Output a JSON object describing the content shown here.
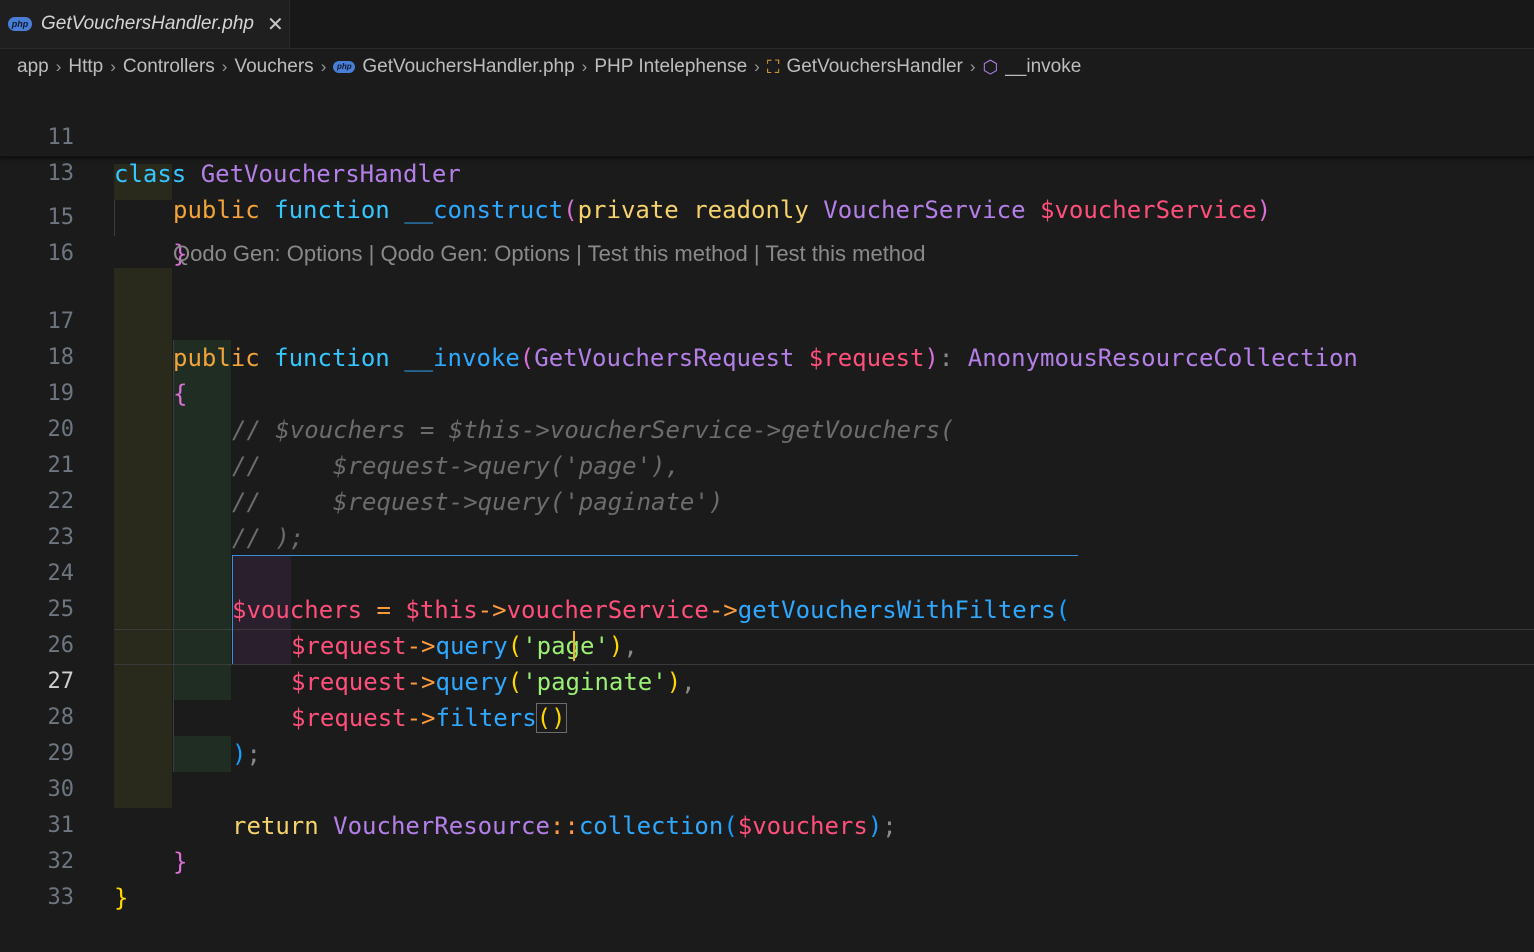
{
  "tab": {
    "icon": "php",
    "title": "GetVouchersHandler.php",
    "close": "✕"
  },
  "breadcrumb": {
    "items": [
      "app",
      "Http",
      "Controllers",
      "Vouchers",
      "GetVouchersHandler.php",
      "PHP Intelephense",
      "GetVouchersHandler",
      "__invoke"
    ],
    "separator": "›",
    "file_icon": "php"
  },
  "codelens": "Qodo Gen: Options | Qodo Gen: Options | Test this method | Test this method",
  "sticky": {
    "line11": {
      "num": "11",
      "class_kw": "class",
      "class_name": "GetVouchersHandler"
    },
    "line13": {
      "num": "13",
      "public": "public",
      "function": "function",
      "name": "__construct",
      "open": "(",
      "mods": "private readonly",
      "type": "VoucherService",
      "var": "$voucherService",
      "close": ")"
    }
  },
  "lines": {
    "l15": {
      "num": "15",
      "text": "}"
    },
    "l16": {
      "num": "16"
    },
    "l17": {
      "num": "17",
      "public": "public",
      "function": "function",
      "name": "__invoke",
      "open": "(",
      "type": "GetVouchersRequest",
      "var": "$request",
      "close": ")",
      "colon": ":",
      "ret": "AnonymousResourceCollection"
    },
    "l18": {
      "num": "18",
      "text": "{"
    },
    "l19": {
      "num": "19",
      "text": "// $vouchers = $this->voucherService->getVouchers("
    },
    "l20": {
      "num": "20",
      "text": "//     $request->query('page'),"
    },
    "l21": {
      "num": "21",
      "text": "//     $request->query('paginate')"
    },
    "l22": {
      "num": "22",
      "text": "// );"
    },
    "l23": {
      "num": "23"
    },
    "l24": {
      "num": "24",
      "var": "$vouchers",
      "eq": "=",
      "this": "$this",
      "arrow": "->",
      "prop": "voucherService",
      "method": "getVouchersWithFilters",
      "open": "("
    },
    "l25": {
      "num": "25",
      "var": "$request",
      "arrow": "->",
      "method": "query",
      "open": "(",
      "arg": "'page'",
      "close": ")",
      "comma": ","
    },
    "l26": {
      "num": "26",
      "var": "$request",
      "arrow": "->",
      "method": "query",
      "open": "(",
      "arg": "'paginate'",
      "close": ")",
      "comma": ","
    },
    "l27": {
      "num": "27",
      "var": "$request",
      "arrow": "->",
      "method": "filters",
      "parens": "()"
    },
    "l28": {
      "num": "28",
      "close": ")",
      "semi": ";"
    },
    "l29": {
      "num": "29"
    },
    "l30": {
      "num": "30",
      "return": "return",
      "cls": "VoucherResource",
      "sep": "::",
      "method": "collection",
      "open": "(",
      "var": "$vouchers",
      "close": ")",
      "semi": ";"
    },
    "l31": {
      "num": "31",
      "text": "}"
    },
    "l32": {
      "num": "32",
      "text": "}"
    },
    "l33": {
      "num": "33"
    }
  }
}
